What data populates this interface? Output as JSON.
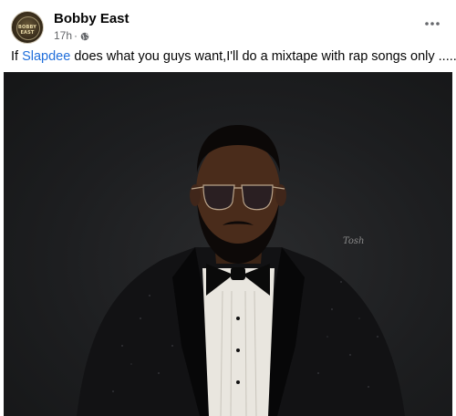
{
  "post": {
    "author": "Bobby East",
    "avatar_text": "BOBBY EAST",
    "time": "17h",
    "separator": "·",
    "audience_icon": "globe-icon",
    "more_icon": "more-options-icon",
    "text_before": "If ",
    "mention": "Slapdee",
    "text_after": " does what you guys want,I'll do a mixtape with rap songs only ......",
    "photo_signature": "Tosh",
    "colors": {
      "mention": "#216fdb",
      "meta": "#65676b",
      "photo_bg": "#1d1e20"
    }
  }
}
